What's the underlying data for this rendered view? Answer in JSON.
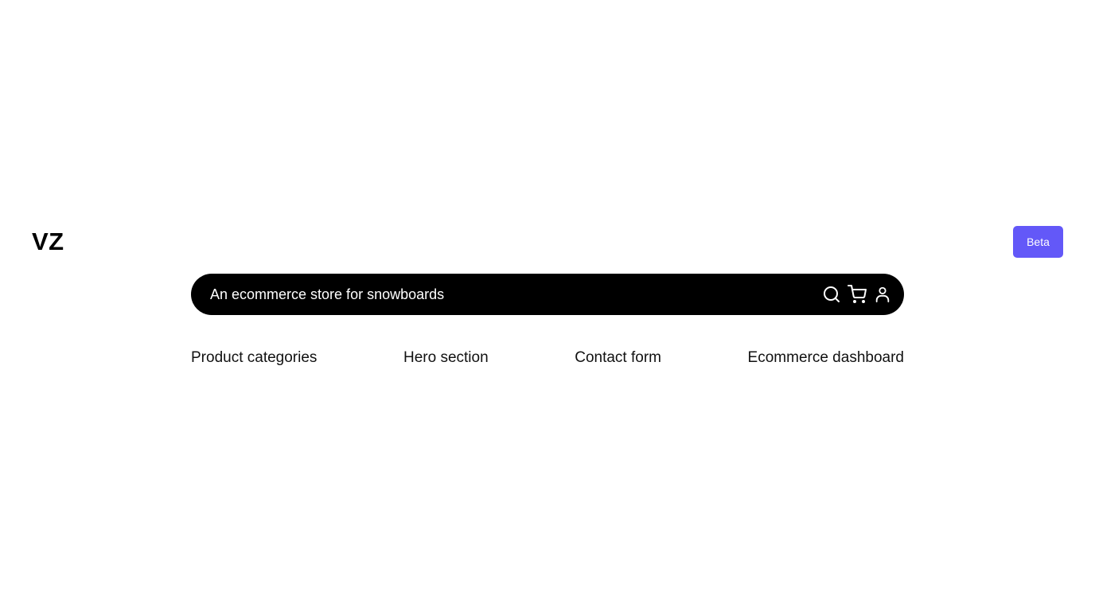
{
  "brand": {
    "logo_text": "VZ"
  },
  "header": {
    "beta_label": "Beta"
  },
  "prompt": {
    "placeholder": "An ecommerce store for snowboards",
    "icons": [
      "search-icon",
      "cart-icon",
      "user-icon"
    ]
  },
  "suggestions": [
    {
      "label": "Product categories"
    },
    {
      "label": "Hero section"
    },
    {
      "label": "Contact form"
    },
    {
      "label": "Ecommerce dashboard"
    }
  ],
  "colors": {
    "accent": "#6358f8",
    "bar_background": "#000000",
    "page_background": "#ffffff"
  }
}
